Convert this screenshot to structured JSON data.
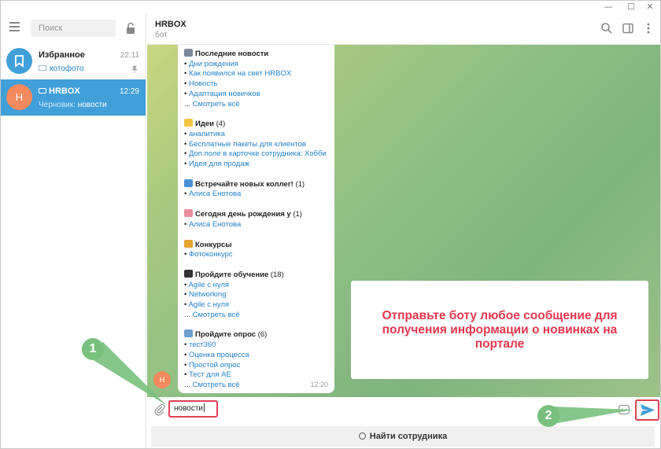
{
  "sidebar": {
    "search_placeholder": "Поиск",
    "chats": [
      {
        "name": "Избранное",
        "time": "22:11",
        "preview": "котофото",
        "avatar_color": "#419fd9"
      },
      {
        "name": "HRBOX",
        "time": "12:29",
        "preview_label": "Черновик:",
        "preview": "новости",
        "avatar_letter": "Н",
        "avatar_color": "#f3895c"
      }
    ]
  },
  "header": {
    "title": "HRBOX",
    "subtitle": "бот"
  },
  "message": {
    "time": "12:20",
    "sections": [
      {
        "title": "Последние новости",
        "count": "",
        "emoji": "newspaper-icon",
        "items": [
          "Дни рождения",
          "Как появился на свет HRBOX",
          "Новость",
          "Адаптация новичков"
        ],
        "more": "Смотреть всё"
      },
      {
        "title": "Идеи",
        "count": "(4)",
        "emoji": "lightbulb-icon",
        "items": [
          "аналитика",
          "Бесплатные пакеты для клиентов",
          "Доп.поле в карточке сотрудника: Хобби",
          "Идея для продаж"
        ],
        "more": ""
      },
      {
        "title": "Встречайте новых коллег!",
        "count": "(1)",
        "emoji": "new-badge-icon",
        "items": [
          "Алиса Енотова"
        ],
        "more": ""
      },
      {
        "title": "Сегодня день рождения у",
        "count": "(1)",
        "emoji": "cake-icon",
        "items": [
          "Алиса Енотова"
        ],
        "more": ""
      },
      {
        "title": "Конкурсы",
        "count": "",
        "emoji": "medal-icon",
        "items": [
          "Фотоконкурс"
        ],
        "more": ""
      },
      {
        "title": "Пройдите обучение",
        "count": "(18)",
        "emoji": "graduation-cap-icon",
        "items": [
          "Agile с нуля",
          "Networking",
          "Agile с нуля"
        ],
        "more": "Смотреть всё"
      },
      {
        "title": "Пройдите опрос",
        "count": "(6)",
        "emoji": "ballot-box-icon",
        "items": [
          "тест360",
          "Оценка процесса",
          "Простой опрос",
          "Тест для АЕ"
        ],
        "more": "Смотреть всё"
      }
    ]
  },
  "bot_avatar_letter": "Н",
  "callout_text": "Отправьте боту любое сообщение для получения информации о новинках на портале",
  "input": {
    "value": "новости"
  },
  "find_button_label": "Найти сотрудника",
  "annotations": {
    "badge1": "1",
    "badge2": "2"
  },
  "colors": {
    "accent": "#419fd9",
    "highlight": "#e04050",
    "annotation": "#78c07e",
    "callout_text": "#e5374e"
  }
}
